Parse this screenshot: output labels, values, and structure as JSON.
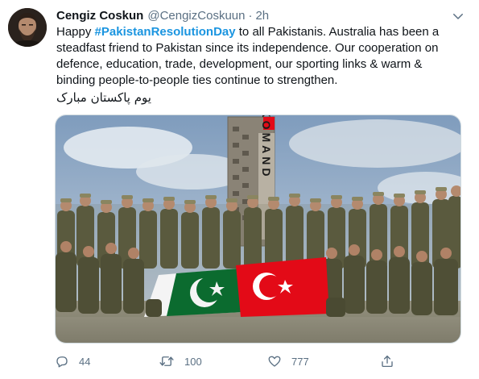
{
  "tweet": {
    "author_name": "Cengiz Coskun",
    "handle": "@CengizCoskuun",
    "separator": "·",
    "time": "2h",
    "text_before": "Happy ",
    "hashtag": "#PakistanResolutionDay",
    "text_after": " to all Pakistanis. Australia has been a steadfast friend to Pakistan since its independence. Our cooperation on defence, education, trade, development, our sporting links & warm & binding people-to-people ties continue to strengthen.",
    "urdu_line": "یوم پاکستان مبارک",
    "photo": {
      "tower_text": "KOMAND"
    }
  },
  "actions": {
    "reply_count": "44",
    "retweet_count": "100",
    "like_count": "777"
  },
  "icons": {
    "caret": "chevron-down-icon",
    "reply": "reply-icon",
    "retweet": "retweet-icon",
    "like": "heart-icon",
    "share": "share-icon"
  },
  "colors": {
    "hashtag": "#1b95e0",
    "secondary_text": "#5b7083",
    "pakistan_green": "#0b6b2f",
    "turkey_red": "#e30a17"
  }
}
